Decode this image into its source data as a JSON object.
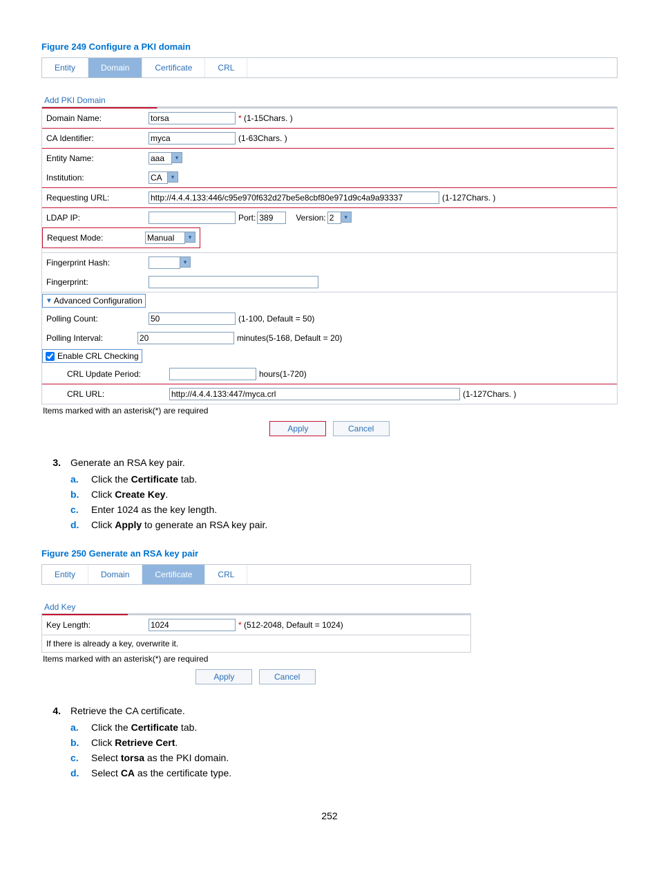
{
  "figure249": {
    "title": "Figure 249 Configure a PKI domain",
    "tabs": [
      "Entity",
      "Domain",
      "Certificate",
      "CRL"
    ],
    "active_tab": 1,
    "section": "Add PKI Domain",
    "fields": {
      "domain_name": {
        "label": "Domain Name:",
        "value": "torsa",
        "hint": "* (1-15Chars. )"
      },
      "ca_identifier": {
        "label": "CA Identifier:",
        "value": "myca",
        "hint": "(1-63Chars. )"
      },
      "entity_name": {
        "label": "Entity Name:",
        "value": "aaa"
      },
      "institution": {
        "label": "Institution:",
        "value": "CA"
      },
      "requesting_url": {
        "label": "Requesting URL:",
        "value": "http://4.4.4.133:446/c95e970f632d27be5e8cbf80e971d9c4a9a93337",
        "hint": "(1-127Chars. )"
      },
      "ldap_ip": {
        "label": "LDAP IP:",
        "value": "",
        "port_label": "Port:",
        "port": "389",
        "version_label": "Version:",
        "version": "2"
      },
      "request_mode": {
        "label": "Request Mode:",
        "value": "Manual"
      },
      "fingerprint_hash": {
        "label": "Fingerprint Hash:",
        "value": ""
      },
      "fingerprint": {
        "label": "Fingerprint:",
        "value": ""
      },
      "advanced": "Advanced Configuration",
      "polling_count": {
        "label": "Polling Count:",
        "value": "50",
        "hint": "(1-100, Default = 50)"
      },
      "polling_interval": {
        "label": "Polling Interval:",
        "value": "20",
        "hint": "minutes(5-168, Default = 20)"
      },
      "enable_crl": {
        "label": "Enable CRL Checking",
        "checked": true
      },
      "crl_update": {
        "label": "CRL Update Period:",
        "value": "",
        "hint": "hours(1-720)"
      },
      "crl_url": {
        "label": "CRL URL:",
        "value": "http://4.4.4.133:447/myca.crl",
        "hint": "(1-127Chars. )"
      }
    },
    "footnote": "Items marked with an asterisk(*) are required",
    "buttons": {
      "apply": "Apply",
      "cancel": "Cancel"
    }
  },
  "step3": {
    "num": "3.",
    "text": "Generate an RSA key pair.",
    "sub": [
      {
        "let": "a.",
        "pre": "Click the ",
        "bold": "Certificate",
        "post": " tab."
      },
      {
        "let": "b.",
        "pre": "Click ",
        "bold": "Create Key",
        "post": "."
      },
      {
        "let": "c.",
        "pre": "Enter 1024 as the key length.",
        "bold": "",
        "post": ""
      },
      {
        "let": "d.",
        "pre": "Click ",
        "bold": "Apply",
        "post": " to generate an RSA key pair."
      }
    ]
  },
  "figure250": {
    "title": "Figure 250 Generate an RSA key pair",
    "tabs": [
      "Entity",
      "Domain",
      "Certificate",
      "CRL"
    ],
    "active_tab": 2,
    "section": "Add Key",
    "fields": {
      "key_length": {
        "label": "Key Length:",
        "value": "1024",
        "hint": "* (512-2048, Default = 1024)"
      },
      "note": "If there is already a key, overwrite it."
    },
    "footnote": "Items marked with an asterisk(*) are required",
    "buttons": {
      "apply": "Apply",
      "cancel": "Cancel"
    }
  },
  "step4": {
    "num": "4.",
    "text": "Retrieve the CA certificate.",
    "sub": [
      {
        "let": "a.",
        "pre": "Click the ",
        "bold": "Certificate",
        "post": " tab."
      },
      {
        "let": "b.",
        "pre": "Click ",
        "bold": "Retrieve Cert",
        "post": "."
      },
      {
        "let": "c.",
        "pre": "Select ",
        "bold": "torsa",
        "post": " as the PKI domain."
      },
      {
        "let": "d.",
        "pre": "Select ",
        "bold": "CA",
        "post": " as the certificate type."
      }
    ]
  },
  "page": "252"
}
